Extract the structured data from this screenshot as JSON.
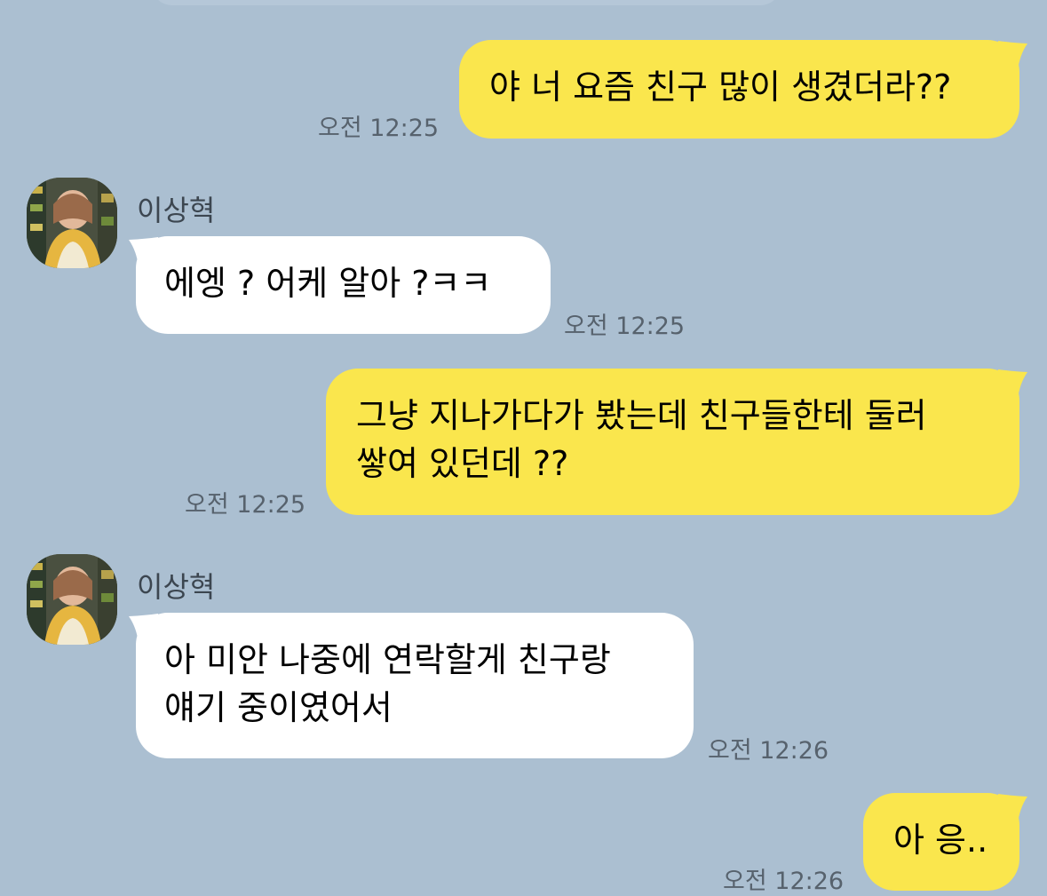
{
  "messages": [
    {
      "text": "야 너 요즘 친구 많이 생겼더라??",
      "time": "오전 12:25"
    },
    {
      "sender": "이상혁",
      "text": "에엥 ? 어케 알아 ?ㅋㅋ",
      "time": "오전 12:25"
    },
    {
      "lines": [
        "그냥 지나가다가 봤는데 친구들한테 둘러",
        "쌓여 있던데 ??"
      ],
      "time": "오전 12:25"
    },
    {
      "sender": "이상혁",
      "lines": [
        "아 미안 나중에 연락할게 친구랑",
        "얘기 중이였어서"
      ],
      "time": "오전 12:26"
    },
    {
      "text": "아 응..",
      "time": "오전 12:26"
    }
  ],
  "colors": {
    "background": "#abbfd1",
    "my_bubble": "#fae64d",
    "their_bubble": "#ffffff",
    "timestamp": "#57626d"
  }
}
